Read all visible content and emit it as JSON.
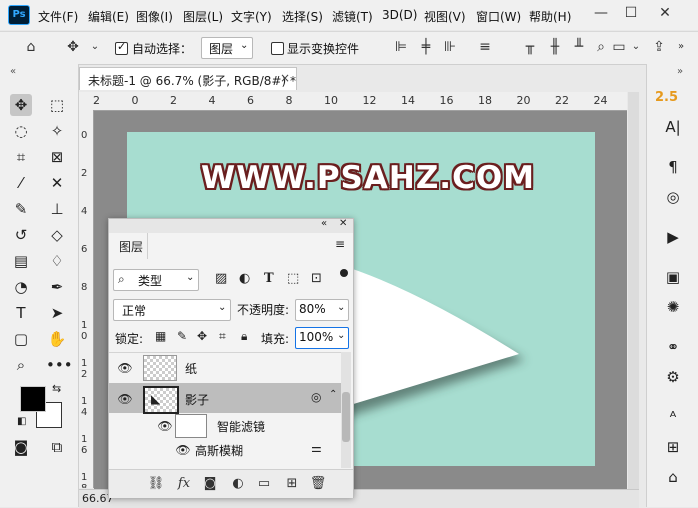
{
  "app": {
    "logo": "Ps"
  },
  "menu": [
    "文件(F)",
    "编辑(E)",
    "图像(I)",
    "图层(L)",
    "文字(Y)",
    "选择(S)",
    "滤镜(T)",
    "3D(D)",
    "视图(V)",
    "窗口(W)",
    "帮助(H)"
  ],
  "window_controls": {
    "minimize": "—",
    "maximize": "☐",
    "close": "✕"
  },
  "options": {
    "auto_select_label": "自动选择：",
    "auto_select_checked": true,
    "auto_select_target": "图层",
    "show_transform_label": "显示变换控件"
  },
  "document": {
    "tab_label": "未标题-1 @ 66.7% (影子, RGB/8#) *",
    "close": "×",
    "zoom": "66.67",
    "canvas_color": "#a7ddd0",
    "banner_text": "WWW.PSAHZ.COM"
  },
  "ruler": {
    "top_ticks": [
      "2",
      "0",
      "2",
      "4",
      "6",
      "8",
      "10",
      "12",
      "14",
      "16",
      "18",
      "20",
      "22",
      "24"
    ],
    "left_ticks": [
      "0",
      "2",
      "4",
      "6",
      "8",
      "1\n0",
      "1\n2",
      "1\n4",
      "1\n6",
      "1\n8",
      "2"
    ]
  },
  "right_strip": {
    "char_size": "2.5"
  },
  "layers_panel": {
    "tab": "图层",
    "filter_kind": "类型",
    "blend_mode": "正常",
    "opacity_label": "不透明度:",
    "opacity_value": "80%",
    "lock_label": "锁定:",
    "fill_label": "填充:",
    "fill_value": "100%",
    "layers": [
      {
        "name": "纸",
        "selected": false
      },
      {
        "name": "影子",
        "selected": true
      }
    ],
    "smart_filters_label": "智能滤镜",
    "filter_item": "高斯模糊"
  },
  "colors": {
    "foreground": "#000000",
    "background": "#ffffff",
    "selected_row": "#bdbdbd",
    "accent": "#e69a1e"
  }
}
